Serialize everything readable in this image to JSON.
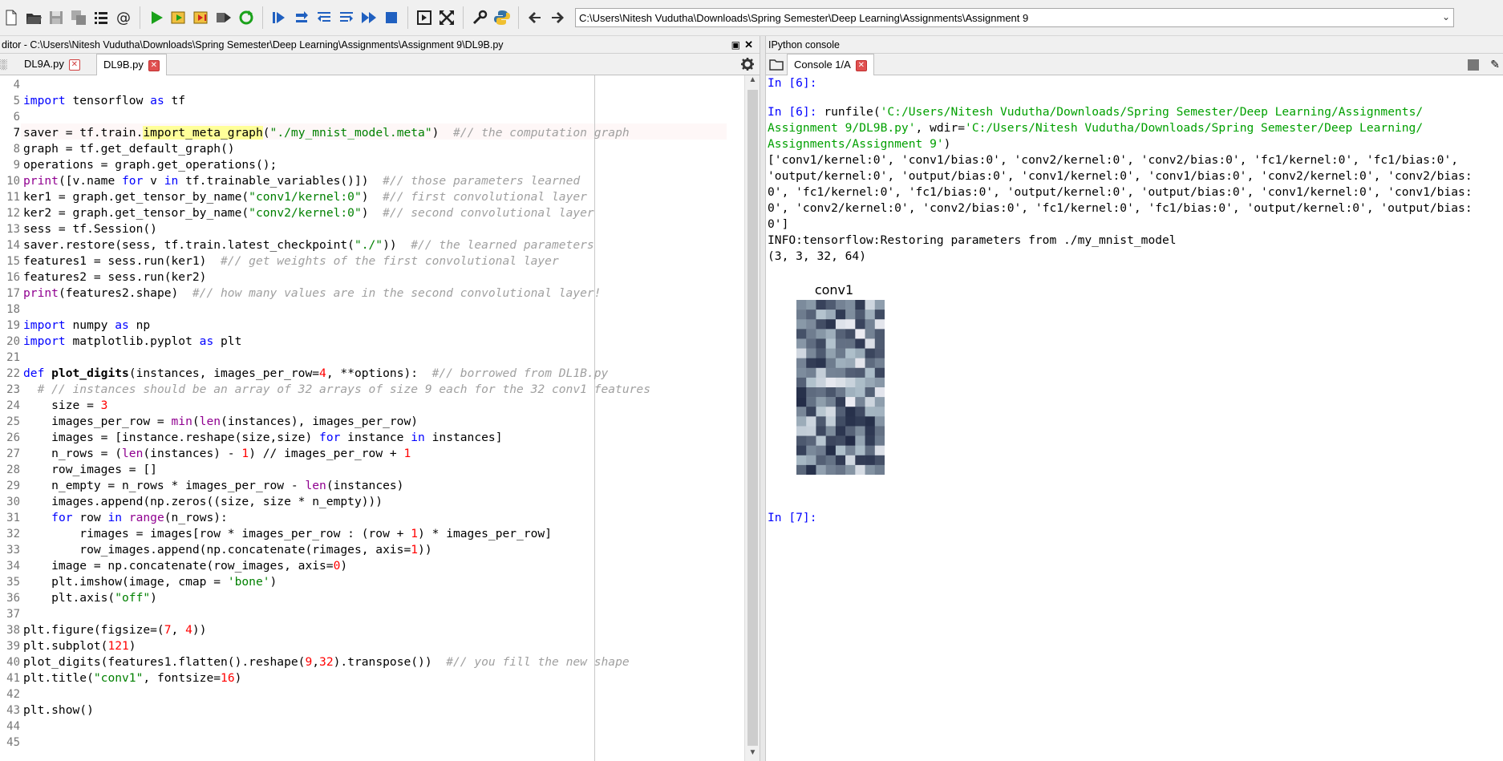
{
  "toolbar": {
    "buttons": [
      "new-file-icon",
      "open-folder-icon",
      "save-icon",
      "save-all-icon",
      "list-icon",
      "at-icon",
      "run-icon",
      "run-cell-icon",
      "run-cell-advance-icon",
      "run-selection-icon",
      "rerun-icon",
      "debug-icon",
      "step-icon",
      "step-into-icon",
      "step-return-icon",
      "continue-icon",
      "stop-icon",
      "maximize-pane-icon",
      "fullscreen-icon",
      "wrench-icon",
      "python-icon",
      "back-icon",
      "forward-icon"
    ],
    "path": "C:\\Users\\Nitesh Vudutha\\Downloads\\Spring Semester\\Deep Learning\\Assignments\\Assignment 9"
  },
  "editor": {
    "title": "ditor - C:\\Users\\Nitesh Vudutha\\Downloads\\Spring Semester\\Deep Learning\\Assignments\\Assignment 9\\DL9B.py",
    "tabs": [
      {
        "label": "DL9A.py"
      },
      {
        "label": "DL9B.py"
      }
    ],
    "line_numbers": [
      "4",
      "5",
      "6",
      "7",
      "8",
      "9",
      "10",
      "11",
      "12",
      "13",
      "14",
      "15",
      "16",
      "17",
      "18",
      "19",
      "20",
      "21",
      "22",
      "23",
      "24",
      "25",
      "26",
      "27",
      "28",
      "29",
      "30",
      "31",
      "32",
      "33",
      "34",
      "35",
      "36",
      "37",
      "38",
      "39",
      "40",
      "41",
      "42",
      "43",
      "44",
      "45"
    ],
    "current_line": "7"
  },
  "console": {
    "title": "IPython console",
    "tab_label": "Console 1/A",
    "prompt_6": "In [6]:",
    "prompt_7": "In [7]:",
    "run_cmd": "runfile(",
    "run_arg1": "'C:/Users/Nitesh Vudutha/Downloads/Spring Semester/Deep Learning/Assignments/",
    "run_arg1b": "Assignment 9/DL9B.py'",
    "run_wdir": ", wdir=",
    "run_arg2": "'C:/Users/Nitesh Vudutha/Downloads/Spring Semester/Deep Learning/",
    "run_arg2b": "Assignments/Assignment 9'",
    "run_close": ")",
    "output_lines": [
      "['conv1/kernel:0', 'conv1/bias:0', 'conv2/kernel:0', 'conv2/bias:0', 'fc1/kernel:0', 'fc1/bias:0',",
      "'output/kernel:0', 'output/bias:0', 'conv1/kernel:0', 'conv1/bias:0', 'conv2/kernel:0', 'conv2/bias:",
      "0', 'fc1/kernel:0', 'fc1/bias:0', 'output/kernel:0', 'output/bias:0', 'conv1/kernel:0', 'conv1/bias:",
      "0', 'conv2/kernel:0', 'conv2/bias:0', 'fc1/kernel:0', 'fc1/bias:0', 'output/kernel:0', 'output/bias:",
      "0']",
      "INFO:tensorflow:Restoring parameters from ./my_mnist_model",
      "(3, 3, 32, 64)"
    ],
    "plot_title": "conv1",
    "plot_grid": {
      "rows": 18,
      "cols": 9,
      "cmap": "bone"
    }
  }
}
